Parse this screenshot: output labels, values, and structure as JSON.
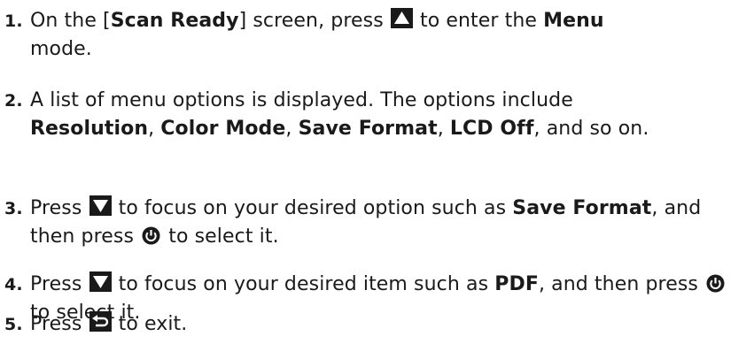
{
  "steps": [
    {
      "number": "1.",
      "t1": "On the [",
      "b1": "Scan Ready",
      "t2": "] screen, press",
      "t3": "to enter the",
      "b2": "Menu",
      "t4": "mode."
    },
    {
      "number": "2.",
      "t1": "A list of menu options is displayed. The options include",
      "b1": "Resolution",
      "t2": ",",
      "b2": "Color Mode",
      "t3": ",",
      "b3": "Save Format",
      "t4": ",",
      "b4": "LCD Off",
      "t5": ", and so on."
    },
    {
      "number": "3.",
      "t1": "Press",
      "t2": "to focus on your desired option such as",
      "b1": "Save Format",
      "t3": ", and then press",
      "t4": "to select it."
    },
    {
      "number": "4.",
      "t1": "Press",
      "t2": "to focus on your desired item such as",
      "b1": "PDF",
      "t3": ", and then press",
      "t4": "to select it."
    },
    {
      "number": "5.",
      "t1": "Press",
      "t2": "to exit."
    }
  ],
  "icons": {
    "up": "up-arrow-key-icon",
    "down": "down-arrow-key-icon",
    "power": "power-key-icon",
    "back": "back-key-icon"
  }
}
